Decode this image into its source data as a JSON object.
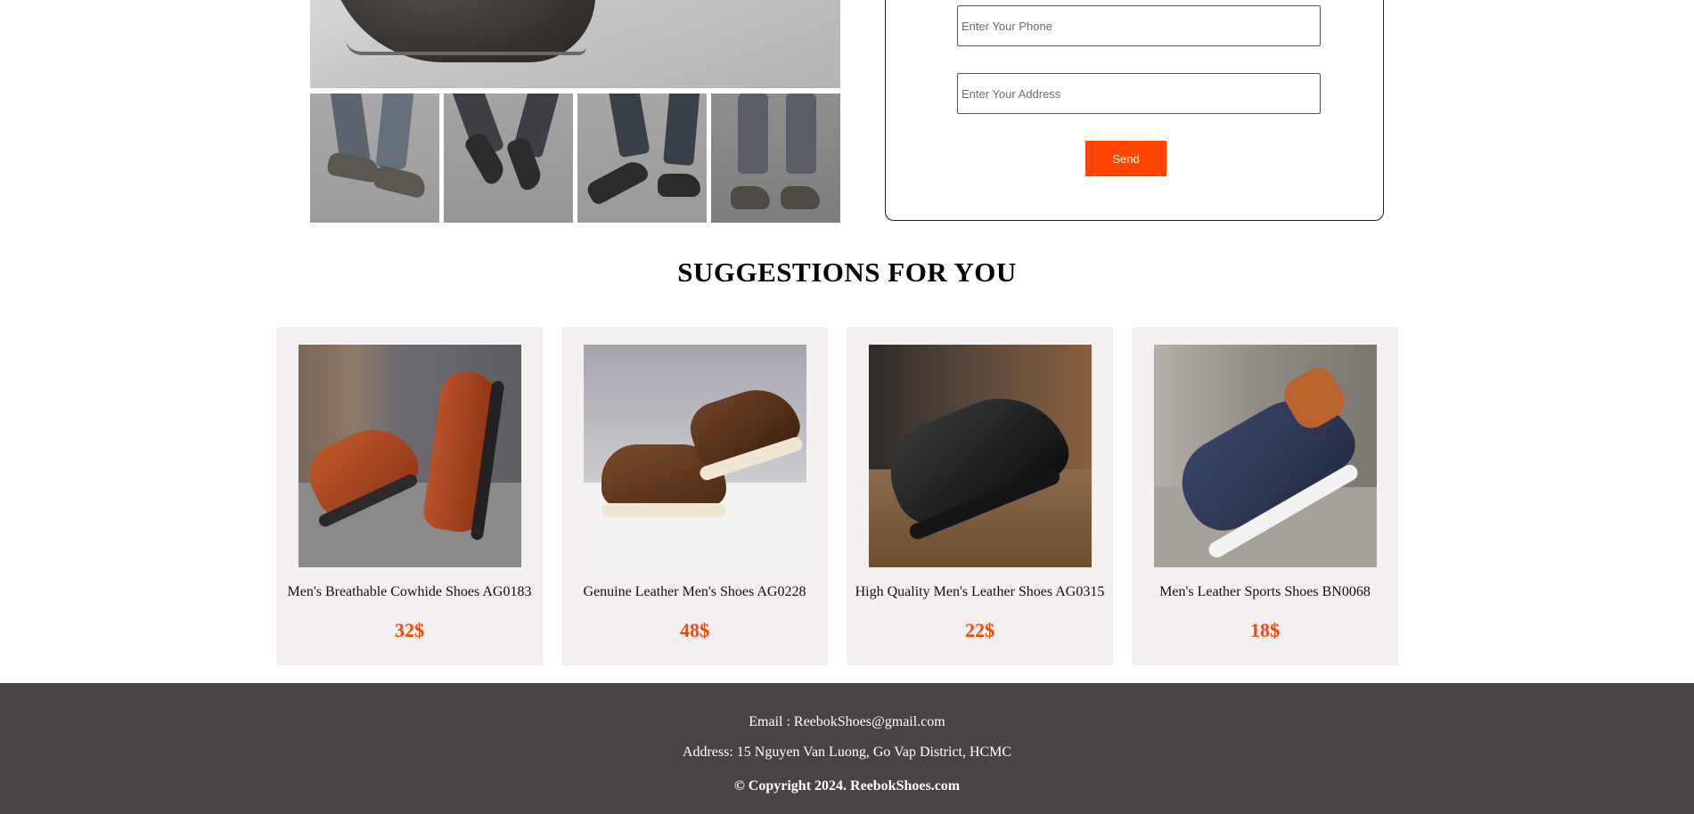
{
  "form": {
    "phone_placeholder": "Enter Your Phone",
    "address_placeholder": "Enter Your Address",
    "send_label": "Send"
  },
  "suggestions": {
    "title": "SUGGESTIONS FOR YOU",
    "price_color": "#ff4500",
    "products": [
      {
        "name": "Men's Breathable Cowhide Shoes AG0183",
        "price": "32$"
      },
      {
        "name": "Genuine Leather Men's Shoes AG0228",
        "price": "48$"
      },
      {
        "name": "High Quality Men's Leather Shoes AG0315",
        "price": "22$"
      },
      {
        "name": "Men's Leather Sports Shoes BN0068",
        "price": "18$"
      }
    ]
  },
  "footer": {
    "email": "Email : ReebokShoes@gmail.com",
    "address": "Address: 15 Nguyen Van Luong, Go Vap District, HCMC",
    "copyright": "© Copyright 2024. ReebokShoes.com"
  },
  "colors": {
    "accent": "#ff4500",
    "footer_bg": "#484444",
    "card_bg": "#f4f0ef"
  }
}
